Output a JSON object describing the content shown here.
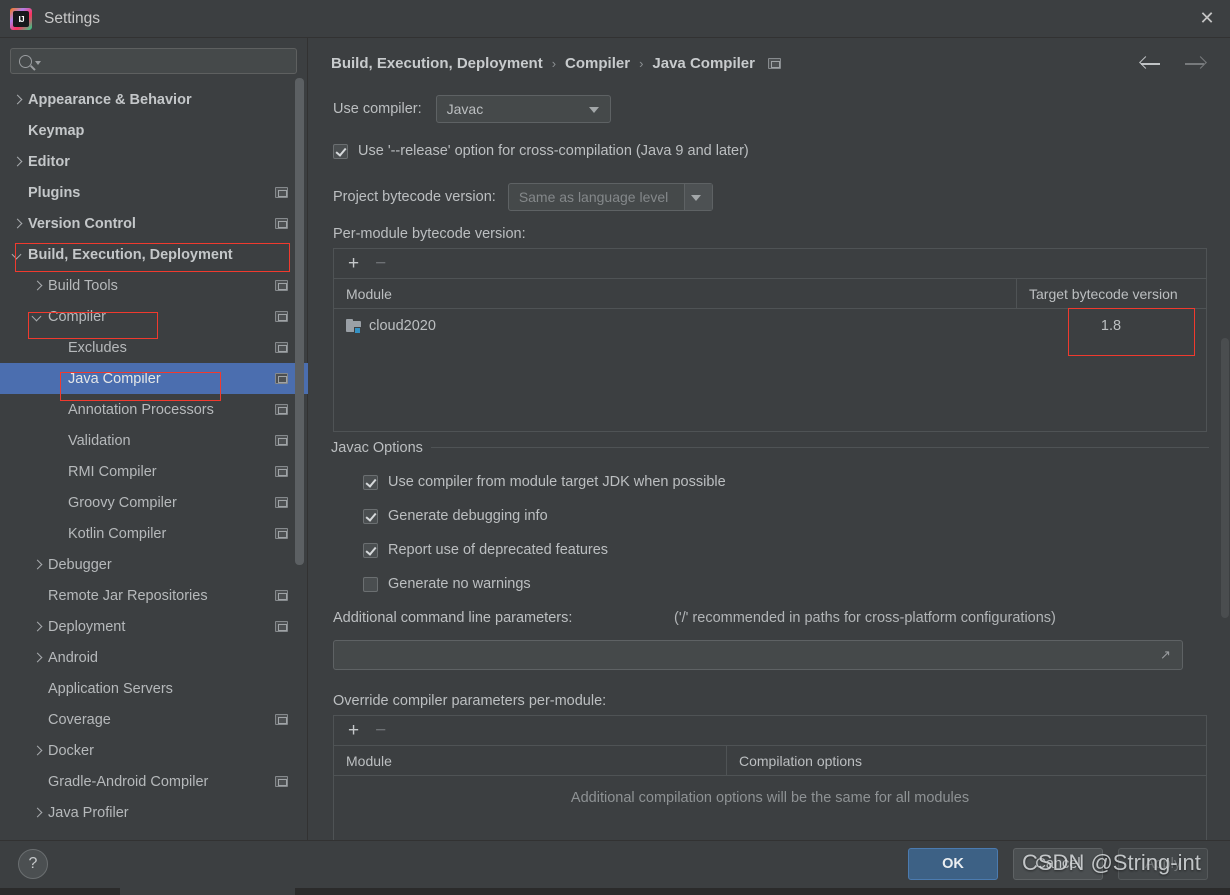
{
  "window": {
    "title": "Settings",
    "logo_text": "IJ",
    "close_icon": "close-icon"
  },
  "search": {
    "value": "",
    "placeholder": ""
  },
  "sidebar": {
    "items": [
      {
        "label": "Appearance & Behavior",
        "indent": 0,
        "arrow": "right",
        "bold": true,
        "badge": false,
        "selected": false
      },
      {
        "label": "Keymap",
        "indent": 0,
        "arrow": "none",
        "bold": true,
        "badge": false,
        "selected": false
      },
      {
        "label": "Editor",
        "indent": 0,
        "arrow": "right",
        "bold": true,
        "badge": false,
        "selected": false
      },
      {
        "label": "Plugins",
        "indent": 0,
        "arrow": "none",
        "bold": true,
        "badge": true,
        "selected": false
      },
      {
        "label": "Version Control",
        "indent": 0,
        "arrow": "right",
        "bold": true,
        "badge": true,
        "selected": false
      },
      {
        "label": "Build, Execution, Deployment",
        "indent": 0,
        "arrow": "down",
        "bold": true,
        "badge": false,
        "selected": false
      },
      {
        "label": "Build Tools",
        "indent": 1,
        "arrow": "right",
        "bold": false,
        "badge": true,
        "selected": false
      },
      {
        "label": "Compiler",
        "indent": 1,
        "arrow": "down",
        "bold": false,
        "badge": true,
        "selected": false
      },
      {
        "label": "Excludes",
        "indent": 2,
        "arrow": "none",
        "bold": false,
        "badge": true,
        "selected": false
      },
      {
        "label": "Java Compiler",
        "indent": 2,
        "arrow": "none",
        "bold": false,
        "badge": true,
        "selected": true
      },
      {
        "label": "Annotation Processors",
        "indent": 2,
        "arrow": "none",
        "bold": false,
        "badge": true,
        "selected": false
      },
      {
        "label": "Validation",
        "indent": 2,
        "arrow": "none",
        "bold": false,
        "badge": true,
        "selected": false
      },
      {
        "label": "RMI Compiler",
        "indent": 2,
        "arrow": "none",
        "bold": false,
        "badge": true,
        "selected": false
      },
      {
        "label": "Groovy Compiler",
        "indent": 2,
        "arrow": "none",
        "bold": false,
        "badge": true,
        "selected": false
      },
      {
        "label": "Kotlin Compiler",
        "indent": 2,
        "arrow": "none",
        "bold": false,
        "badge": true,
        "selected": false
      },
      {
        "label": "Debugger",
        "indent": 1,
        "arrow": "right",
        "bold": false,
        "badge": false,
        "selected": false
      },
      {
        "label": "Remote Jar Repositories",
        "indent": 1,
        "arrow": "none",
        "bold": false,
        "badge": true,
        "selected": false
      },
      {
        "label": "Deployment",
        "indent": 1,
        "arrow": "right",
        "bold": false,
        "badge": true,
        "selected": false
      },
      {
        "label": "Android",
        "indent": 1,
        "arrow": "right",
        "bold": false,
        "badge": false,
        "selected": false
      },
      {
        "label": "Application Servers",
        "indent": 1,
        "arrow": "none",
        "bold": false,
        "badge": false,
        "selected": false
      },
      {
        "label": "Coverage",
        "indent": 1,
        "arrow": "none",
        "bold": false,
        "badge": true,
        "selected": false
      },
      {
        "label": "Docker",
        "indent": 1,
        "arrow": "right",
        "bold": false,
        "badge": false,
        "selected": false
      },
      {
        "label": "Gradle-Android Compiler",
        "indent": 1,
        "arrow": "none",
        "bold": false,
        "badge": true,
        "selected": false
      },
      {
        "label": "Java Profiler",
        "indent": 1,
        "arrow": "right",
        "bold": false,
        "badge": false,
        "selected": false
      }
    ]
  },
  "breadcrumb": {
    "parts": [
      "Build, Execution, Deployment",
      "Compiler",
      "Java Compiler"
    ],
    "separator": "›"
  },
  "nav": {
    "back_icon": "arrow-left-icon",
    "forward_icon": "arrow-right-icon"
  },
  "main": {
    "use_compiler_label": "Use compiler:",
    "use_compiler_value": "Javac",
    "release_option_label": "Use '--release' option for cross-compilation (Java 9 and later)",
    "release_option_checked": true,
    "project_bytecode_label": "Project bytecode version:",
    "project_bytecode_value": "Same as language level",
    "per_module_label": "Per-module bytecode version:",
    "per_module_table": {
      "add_label": "+",
      "remove_label": "−",
      "columns": [
        "Module",
        "Target bytecode version"
      ],
      "rows": [
        {
          "module": "cloud2020",
          "target": "1.8"
        }
      ]
    },
    "javac_group_title": "Javac Options",
    "javac_options": [
      {
        "label": "Use compiler from module target JDK when possible",
        "checked": true
      },
      {
        "label": "Generate debugging info",
        "checked": true
      },
      {
        "label": "Report use of deprecated features",
        "checked": true
      },
      {
        "label": "Generate no warnings",
        "checked": false
      }
    ],
    "additional_params_label": "Additional command line parameters:",
    "additional_params_hint": "('/' recommended in paths for cross-platform configurations)",
    "additional_params_value": "",
    "override_label": "Override compiler parameters per-module:",
    "override_table": {
      "add_label": "+",
      "remove_label": "−",
      "columns": [
        "Module",
        "Compilation options"
      ],
      "empty_text": "Additional compilation options will be the same for all modules"
    }
  },
  "footer": {
    "help_label": "?",
    "ok_label": "OK",
    "cancel_label": "Cancel",
    "apply_label": "Apply"
  },
  "watermark": {
    "text": "CSDN @String-int"
  },
  "colors": {
    "background": "#3c3f41",
    "selection_blue": "#4b6eaf",
    "accent_blue": "#3d6185",
    "annotation_red": "#f03a2e",
    "module_icon_cyan": "#3592c4"
  }
}
